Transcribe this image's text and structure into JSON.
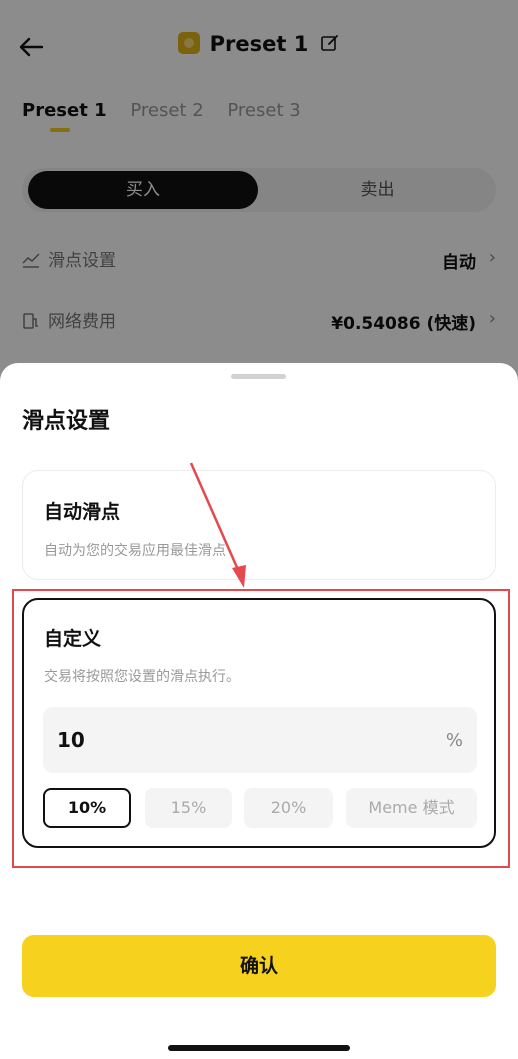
{
  "header": {
    "title": "Preset 1"
  },
  "tabs": [
    {
      "label": "Preset 1",
      "active": true
    },
    {
      "label": "Preset 2",
      "active": false
    },
    {
      "label": "Preset 3",
      "active": false
    }
  ],
  "trade_toggle": {
    "buy_label": "买入",
    "sell_label": "卖出"
  },
  "settings_rows": {
    "slippage": {
      "label": "滑点设置",
      "value": "自动"
    },
    "network_fee": {
      "label": "网络费用",
      "value": "¥0.54086 (快速)"
    }
  },
  "sheet": {
    "title": "滑点设置",
    "auto_option": {
      "title": "自动滑点",
      "description": "自动为您的交易应用最佳滑点"
    },
    "custom_option": {
      "title": "自定义",
      "description": "交易将按照您设置的滑点执行。",
      "input_value": "10",
      "unit": "%",
      "chips": [
        "10%",
        "15%",
        "20%",
        "Meme 模式"
      ],
      "selected_chip": "10%"
    },
    "confirm_label": "确认"
  },
  "colors": {
    "accent": "#f6d11d",
    "annotation": "#e5484d"
  }
}
